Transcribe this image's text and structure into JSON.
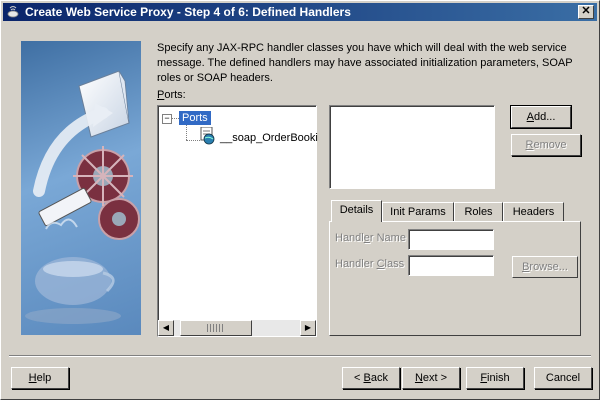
{
  "window": {
    "title": "Create Web Service Proxy - Step 4 of 6: Defined Handlers",
    "close_glyph": "✕"
  },
  "description": "Specify any JAX-RPC handler classes you have which will deal with the web service message. The defined handlers may have associated initialization parameters, SOAP roles or SOAP headers.",
  "ports": {
    "label_mnemonic": "P",
    "label_rest": "orts:",
    "tree": {
      "root_label": "Ports",
      "child_label": "__soap_OrderBooki"
    }
  },
  "handler_buttons": {
    "add_mnemonic": "A",
    "add_rest": "dd...",
    "remove_mnemonic": "R",
    "remove_rest": "emove"
  },
  "tabs": [
    {
      "label": "Details",
      "active": true
    },
    {
      "label": "Init Params",
      "active": false
    },
    {
      "label": "Roles",
      "active": false
    },
    {
      "label": "Headers",
      "active": false
    }
  ],
  "details": {
    "handler_name_pre": "Handl",
    "handler_name_mnemonic": "e",
    "handler_name_post": "r Name",
    "handler_class_pre": "Handler ",
    "handler_class_mnemonic": "C",
    "handler_class_post": "lass",
    "browse_mnemonic": "B",
    "browse_rest": "rowse..."
  },
  "footer": {
    "help_mnemonic": "H",
    "help_rest": "elp",
    "back_pre": "< ",
    "back_mnemonic": "B",
    "back_rest": "ack",
    "next_mnemonic": "N",
    "next_rest": "ext >",
    "finish_mnemonic": "F",
    "finish_rest": "inish",
    "cancel_label": "Cancel"
  },
  "colors": {
    "titlebar_start": "#0a246a",
    "titlebar_end": "#3a6ea5",
    "dialog_bg": "#d4d0c8",
    "selection": "#316ac5"
  }
}
